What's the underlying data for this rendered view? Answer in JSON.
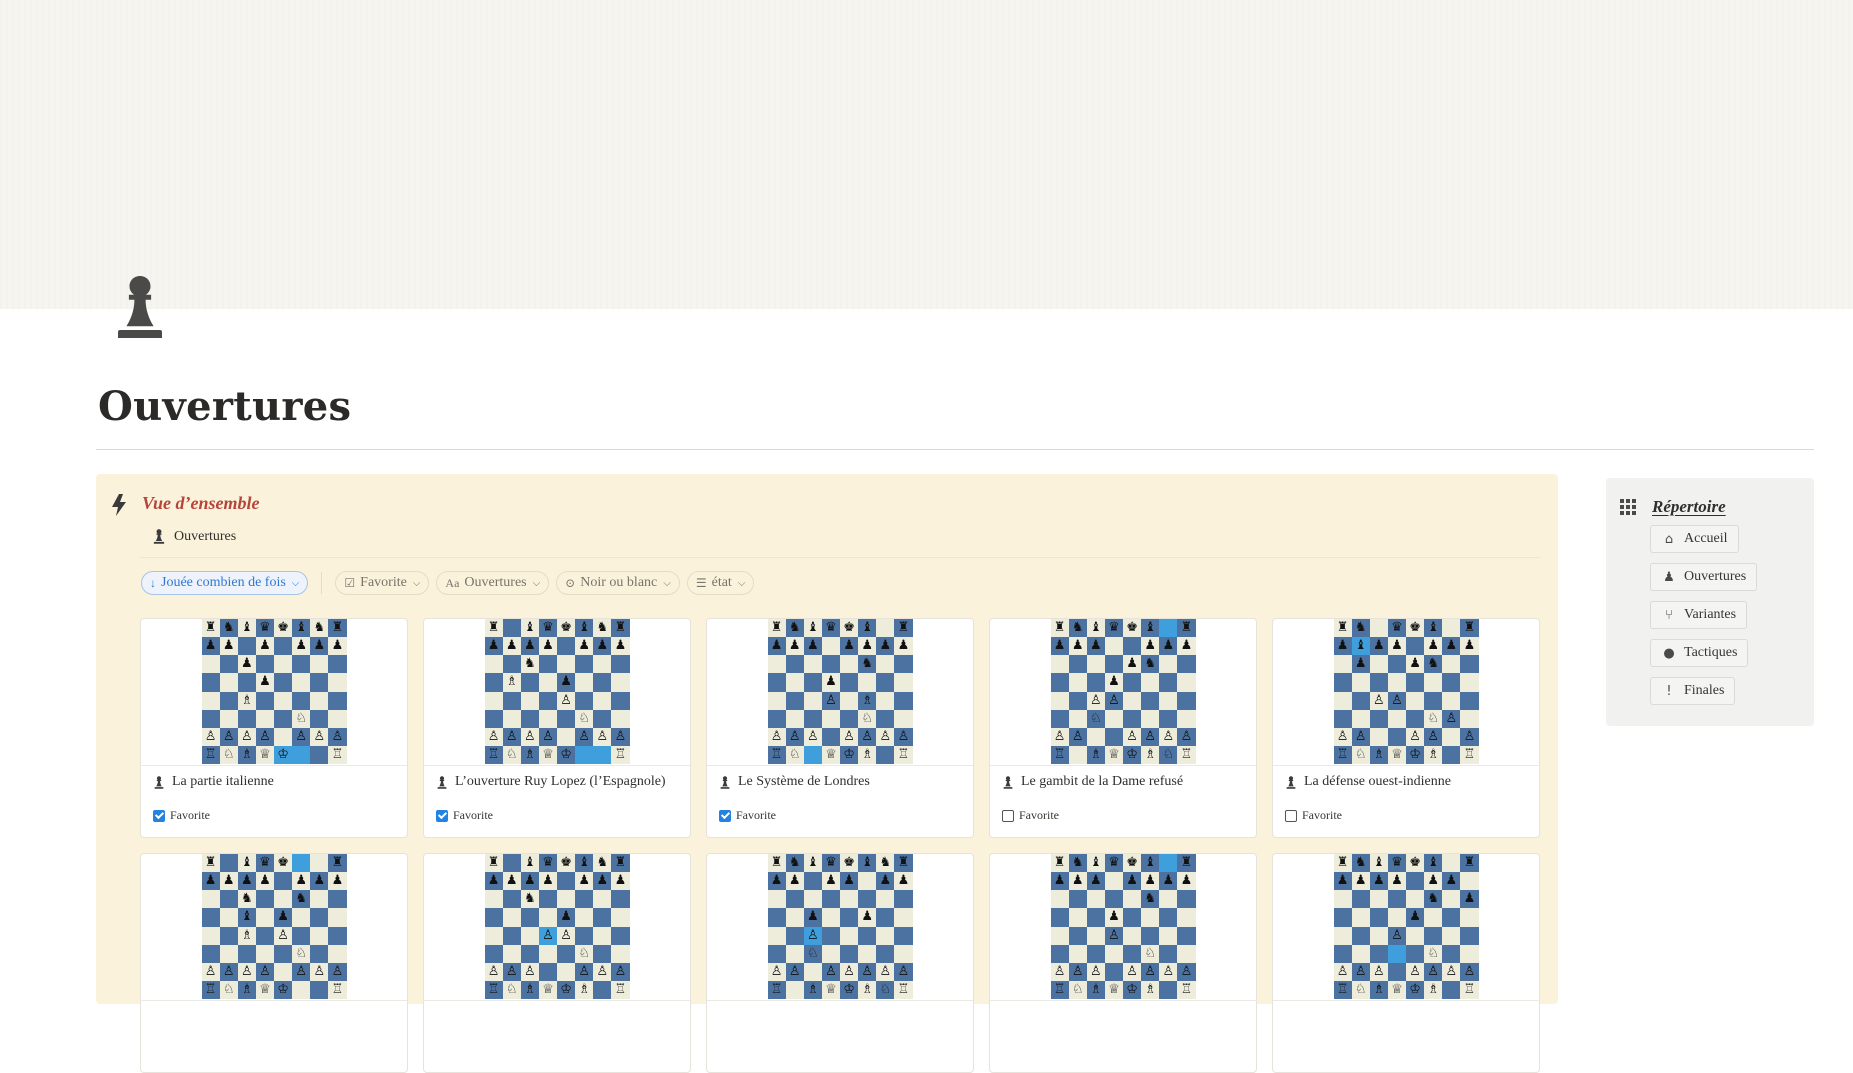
{
  "page": {
    "title": "Ouvertures",
    "icon": "pawn-icon"
  },
  "callout": {
    "icon": "lightning-icon",
    "heading": "Vue d’ensemble",
    "database_link": {
      "icon": "pawn-icon",
      "label": "Ouvertures"
    }
  },
  "filters": {
    "sort": {
      "icon": "arrow-down-icon",
      "label": "Jouée combien de fois"
    },
    "items": [
      {
        "icon": "checkbox-icon",
        "label": "Favorite"
      },
      {
        "icon": "text-icon",
        "label": "Ouvertures"
      },
      {
        "icon": "select-icon",
        "label": "Noir ou blanc"
      },
      {
        "icon": "list-icon",
        "label": "état"
      }
    ]
  },
  "cards": [
    {
      "name": "La partie italienne",
      "favorite_label": "Favorite",
      "favorite": true,
      "board": [
        "rnbqkbnr",
        "pp p ppp",
        "  p     ",
        "   p    ",
        "  B     ",
        "     N  ",
        "PPPP PPP",
        "RNBQK  R"
      ],
      "highlight": [
        "7,4",
        "7,5"
      ]
    },
    {
      "name": "L’ouverture Ruy Lopez (l’Espagnole)",
      "favorite_label": "Favorite",
      "favorite": true,
      "board": [
        "r bqkbnr",
        "pppp ppp",
        "  n     ",
        " B  p   ",
        "    P   ",
        "     N  ",
        "PPPP PPP",
        "RNBQK  R"
      ],
      "highlight": [
        "7,5",
        "7,6"
      ]
    },
    {
      "name": "Le Système de Londres",
      "favorite_label": "Favorite",
      "favorite": true,
      "board": [
        "rnbqkb r",
        "ppp pppp",
        "     n  ",
        "   p    ",
        "   P B  ",
        "     N  ",
        "PPP PPPP",
        "RN QKB R"
      ],
      "highlight": [
        "7,2"
      ]
    },
    {
      "name": "Le gambit de la Dame refusé",
      "favorite_label": "Favorite",
      "favorite": false,
      "board": [
        "rnbqkb r",
        "ppp  ppp",
        "    pn  ",
        "   p    ",
        "  PP    ",
        "  N     ",
        "PP  PPPP",
        "R BQKBNR"
      ],
      "highlight": [
        "0,6"
      ]
    },
    {
      "name": "La défense ouest-indienne",
      "favorite_label": "Favorite",
      "favorite": false,
      "board": [
        "rn qkb r",
        "pbpp ppp",
        " p  pn  ",
        "        ",
        "  PP    ",
        "     NP ",
        "PP  PP P",
        "RNBQKB R"
      ],
      "highlight": [
        "1,1"
      ]
    },
    {
      "name": "",
      "favorite_label": "",
      "favorite": false,
      "board": [
        "r bqk  r",
        "pppp ppp",
        "  n  n  ",
        "  b p   ",
        "  B P   ",
        "     N  ",
        "PPPP PPP",
        "RNBQK  R"
      ],
      "highlight": [
        "0,5"
      ]
    },
    {
      "name": "",
      "favorite_label": "",
      "favorite": false,
      "board": [
        "r bqkbnr",
        "pppp ppp",
        "  n     ",
        "    p   ",
        "   PP   ",
        "     N  ",
        "PPP  PPP",
        "RNBQKB R"
      ],
      "highlight": [
        "4,3"
      ]
    },
    {
      "name": "",
      "favorite_label": "",
      "favorite": false,
      "board": [
        "rnbqkbnr",
        "pp pp pp",
        "        ",
        "  p  p  ",
        "  P     ",
        "  N     ",
        "PP PPPPP",
        "R BQKBNR"
      ],
      "highlight": [
        "4,2"
      ]
    },
    {
      "name": "",
      "favorite_label": "",
      "favorite": false,
      "board": [
        "rnbqkb r",
        "ppp pppp",
        "     n  ",
        "   p    ",
        "   P    ",
        "     N  ",
        "PPP PPPP",
        "RNBQKB R"
      ],
      "highlight": [
        "0,6"
      ]
    },
    {
      "name": "",
      "favorite_label": "",
      "favorite": false,
      "board": [
        "rnbqkb r",
        "pppp pp ",
        "     n p",
        "    p   ",
        "   P    ",
        "     N  ",
        "PPP PPPP",
        "RNBQKB R"
      ],
      "highlight": [
        "5,3"
      ]
    }
  ],
  "sidebar": {
    "icon": "grid-icon",
    "title": "Répertoire",
    "items": [
      {
        "icon": "home-icon",
        "label": "Accueil"
      },
      {
        "icon": "pawn-icon",
        "label": "Ouvertures"
      },
      {
        "icon": "branch-icon",
        "label": "Variantes"
      },
      {
        "icon": "alert-icon",
        "label": "Tactiques"
      },
      {
        "icon": "exclamation-icon",
        "label": "Finales"
      }
    ]
  },
  "colors": {
    "callout_bg": "#fbf2db",
    "heading_red": "#b5453b",
    "board_dark": "#4b72a0",
    "board_light": "#eeeddb",
    "highlight": "#3f9fdc",
    "checkbox_blue": "#2383e2"
  }
}
